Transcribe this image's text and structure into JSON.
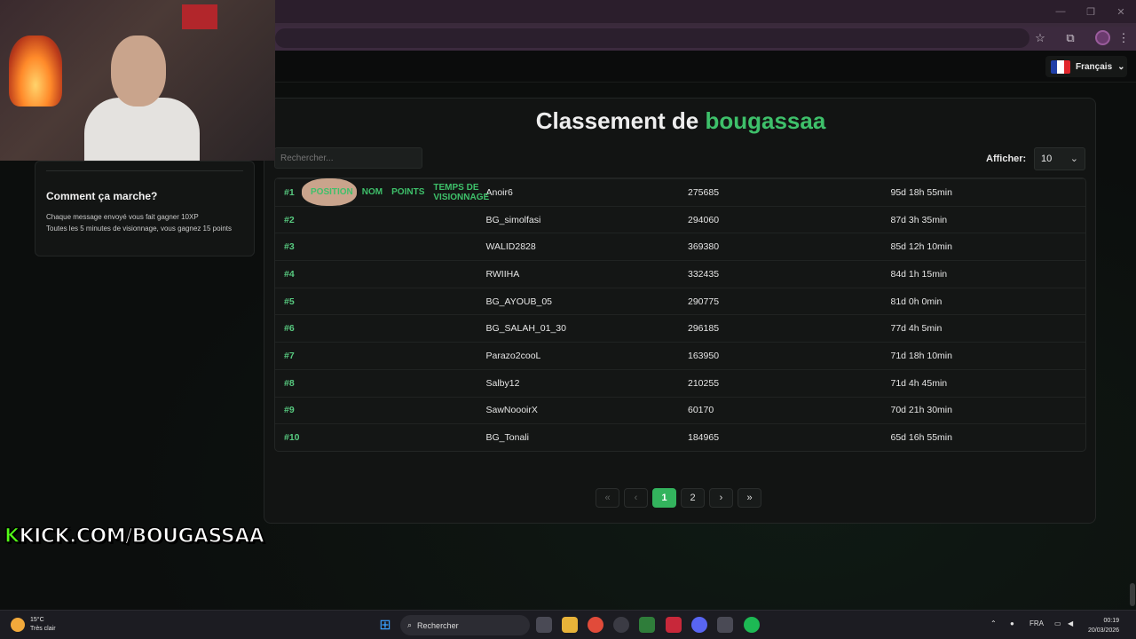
{
  "browser": {
    "minimize_glyph": "—",
    "restore_glyph": "❐",
    "close_glyph": "✕",
    "bookmark_glyph": "☆",
    "extensions_glyph": "⧉",
    "menu_glyph": "⋮"
  },
  "language": {
    "label": "Français",
    "chevron": "⌄",
    "flag_colors": [
      "#1f3fa8",
      "#ffffff",
      "#e1262c"
    ]
  },
  "sidebar": {
    "title": "Comment ça marche?",
    "lines": [
      "Chaque message envoyé vous fait gagner 10XP",
      "Toutes les 5 minutes de visionnage, vous gagnez 15 points"
    ]
  },
  "leaderboard": {
    "title_prefix": "Classement de",
    "title_name": "bougassaa",
    "search_placeholder": "Rechercher...",
    "show_label": "Afficher:",
    "show_value": "10",
    "columns": [
      "POSITION",
      "NOM",
      "POINTS",
      "TEMPS DE VISIONNAGE"
    ],
    "rows": [
      [
        "#1",
        "Anoir6",
        "275685",
        "95d 18h 55min"
      ],
      [
        "#2",
        "BG_simolfasi",
        "294060",
        "87d 3h 35min"
      ],
      [
        "#3",
        "WALID2828",
        "369380",
        "85d 12h 10min"
      ],
      [
        "#4",
        "RWIIHA",
        "332435",
        "84d 1h 15min"
      ],
      [
        "#5",
        "BG_AYOUB_05",
        "290775",
        "81d 0h 0min"
      ],
      [
        "#6",
        "BG_SALAH_01_30",
        "296185",
        "77d 4h 5min"
      ],
      [
        "#7",
        "Parazo2cooL",
        "163950",
        "71d 18h 10min"
      ],
      [
        "#8",
        "Salby12",
        "210255",
        "71d 4h 45min"
      ],
      [
        "#9",
        "SawNoooirX",
        "60170",
        "70d 21h 30min"
      ],
      [
        "#10",
        "BG_Tonali",
        "184965",
        "65d 16h 55min"
      ]
    ],
    "pagination": {
      "first": "«",
      "prev": "‹",
      "pages": [
        "1",
        "2"
      ],
      "current": "1",
      "next": "›",
      "last": "»"
    }
  },
  "overlay": {
    "kick_k": "K",
    "kick_text": "KICK.COM/BOUGASSAA"
  },
  "taskbar": {
    "temperature": "15°C",
    "weather": "Très clair",
    "search_placeholder": "Rechercher",
    "language": "FRA",
    "time": "00:19",
    "date": "20/03/2026"
  },
  "accent_color": "#3ec06a"
}
